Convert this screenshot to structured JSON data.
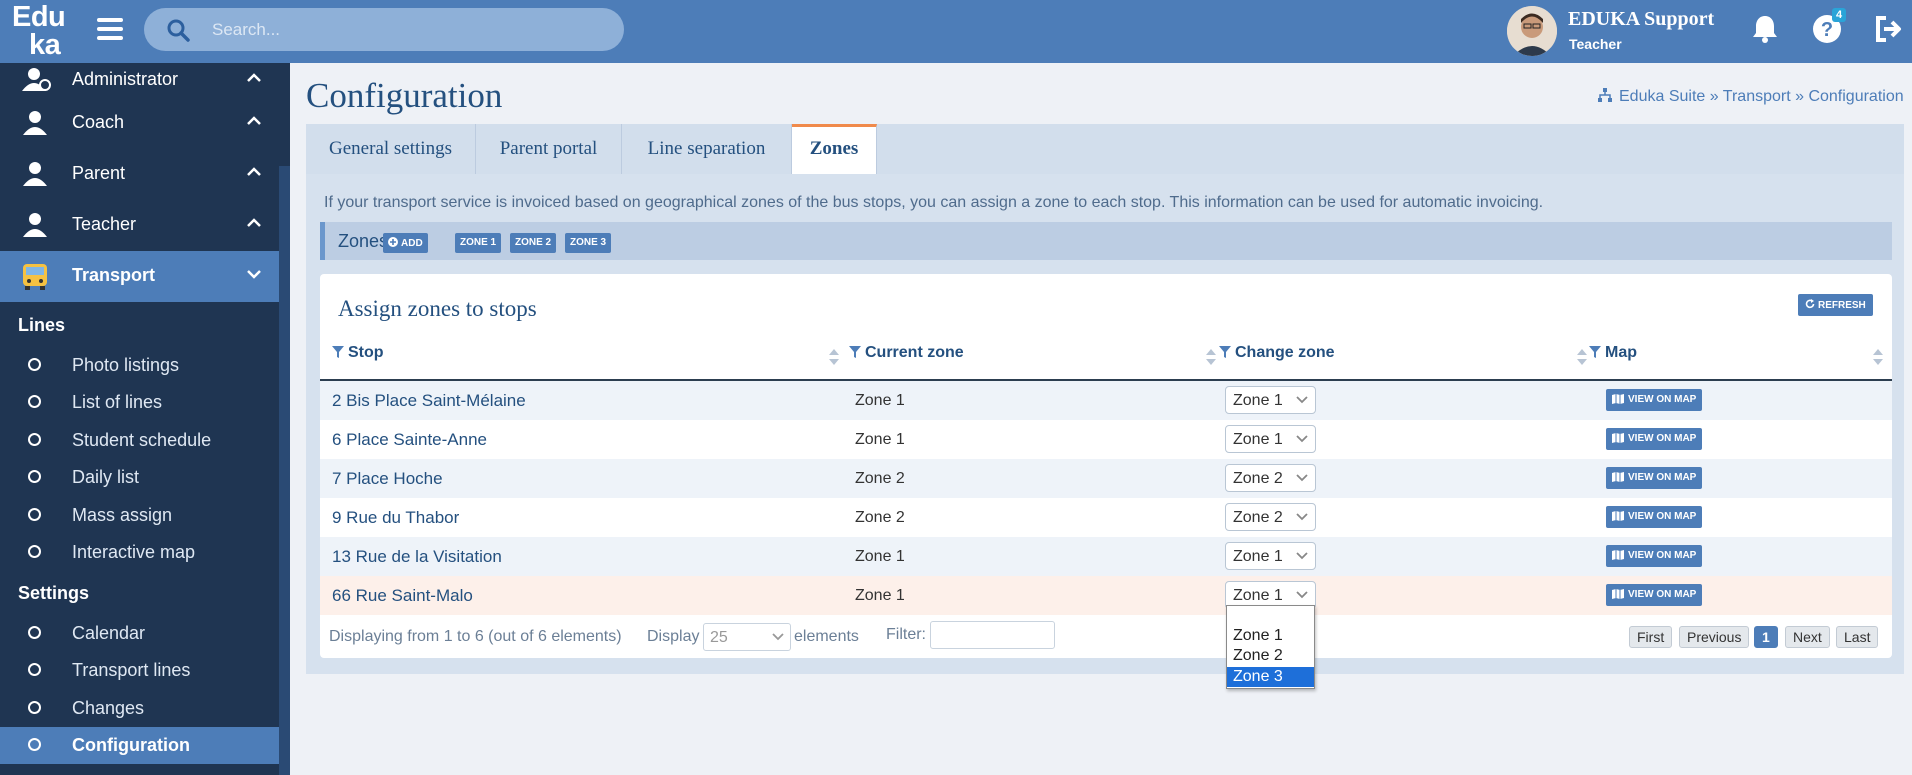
{
  "app": {
    "logo_line1": "Edu",
    "logo_line2": "ka"
  },
  "search": {
    "placeholder": "Search..."
  },
  "user": {
    "name": "EDUKA Support",
    "role": "Teacher",
    "help_badge": "4"
  },
  "sidebar": {
    "menu": [
      {
        "label": "Administrator"
      },
      {
        "label": "Coach"
      },
      {
        "label": "Parent"
      },
      {
        "label": "Teacher"
      },
      {
        "label": "Transport"
      }
    ],
    "sections": [
      {
        "title": "Lines",
        "items": [
          "Photo listings",
          "List of lines",
          "Student schedule",
          "Daily list",
          "Mass assign",
          "Interactive map"
        ]
      },
      {
        "title": "Settings",
        "items": [
          "Calendar",
          "Transport lines",
          "Changes",
          "Configuration"
        ]
      }
    ]
  },
  "page": {
    "title": "Configuration",
    "breadcrumb": "Eduka Suite » Transport » Configuration",
    "tabs": [
      "General settings",
      "Parent portal",
      "Line separation",
      "Zones"
    ],
    "active_tab": "Zones",
    "info": "If your transport service is invoiced based on geographical zones of the bus stops, you can assign a zone to each stop. This information can be used for automatic invoicing.",
    "zones_label": "Zones:",
    "zone_buttons": [
      "ADD",
      "ZONE 1",
      "ZONE 2",
      "ZONE 3"
    ]
  },
  "table": {
    "title": "Assign zones to stops",
    "refresh_label": "REFRESH",
    "columns": [
      "Stop",
      "Current zone",
      "Change zone",
      "Map"
    ],
    "view_label": "VIEW ON MAP",
    "rows": [
      {
        "stop": "2 Bis Place Saint-Mélaine",
        "current": "Zone 1",
        "change": "Zone 1"
      },
      {
        "stop": "6 Place Sainte-Anne",
        "current": "Zone 1",
        "change": "Zone 1"
      },
      {
        "stop": "7 Place Hoche",
        "current": "Zone 2",
        "change": "Zone 2"
      },
      {
        "stop": "9 Rue du Thabor",
        "current": "Zone 2",
        "change": "Zone 2"
      },
      {
        "stop": "13 Rue de la Visitation",
        "current": "Zone 1",
        "change": "Zone 1"
      },
      {
        "stop": "66 Rue Saint-Malo",
        "current": "Zone 1",
        "change": "Zone 1"
      }
    ],
    "dropdown_options": [
      "Zone 1",
      "Zone 2",
      "Zone 3"
    ],
    "dropdown_selected": "Zone 3",
    "footer": {
      "displaying": "Displaying from 1 to 6 (out of 6 elements)",
      "display_label": "Display",
      "display_value": "25",
      "elements_label": "elements",
      "filter_label": "Filter:",
      "pagination": [
        "First",
        "Previous",
        "1",
        "Next",
        "Last"
      ]
    }
  },
  "colors": {
    "primary": "#4d7db8",
    "sidebar": "#1f3552",
    "accent_tab": "#f08a4b",
    "highlight_row": "#fdf0ea"
  }
}
